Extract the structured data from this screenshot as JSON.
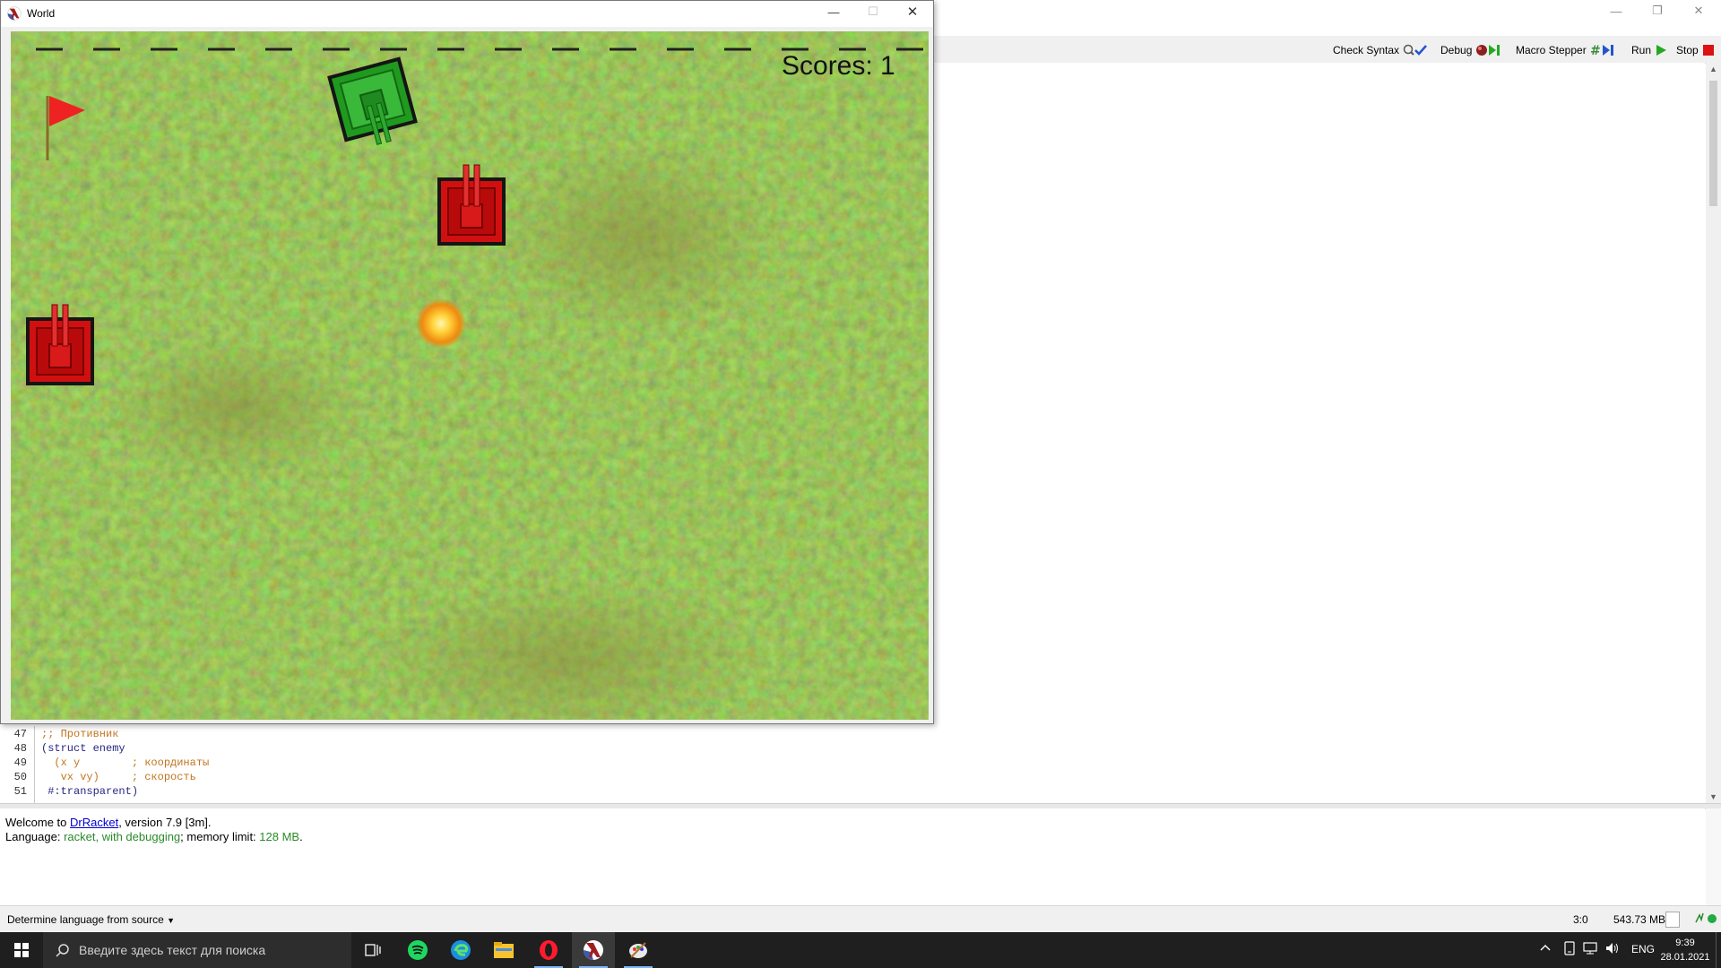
{
  "drracket": {
    "toolbar": {
      "check_syntax": "Check Syntax",
      "debug": "Debug",
      "macro_stepper": "Macro Stepper",
      "run": "Run",
      "stop": "Stop"
    },
    "code_lines": [
      {
        "num": "47",
        "text": ";; Противник"
      },
      {
        "num": "48",
        "text": "(struct enemy"
      },
      {
        "num": "49",
        "text": "  (x y        ; координаты"
      },
      {
        "num": "50",
        "text": "   vx vy)     ; скорость"
      },
      {
        "num": "51",
        "text": " #:transparent)"
      }
    ],
    "repl": {
      "welcome_prefix": "Welcome to ",
      "welcome_link": "DrRacket",
      "welcome_suffix": ", version 7.9 [3m].",
      "lang_label": "Language: ",
      "lang_value": "racket, with debugging",
      "mem_label": "; memory limit: ",
      "mem_value": "128 MB",
      "period": "."
    },
    "status": {
      "language_menu": "Determine language from source",
      "position": "3:0",
      "memory": "543.73 MB"
    }
  },
  "world_window": {
    "title": "World",
    "scores_text": "Scores: 1"
  },
  "taskbar": {
    "search_placeholder": "Введите здесь текст для поиска",
    "lang": "ENG",
    "time": "9:39",
    "date": "28.01.2021"
  },
  "colors": {
    "accent": "#7ab7ff",
    "grass": "#5f8f2c",
    "player_tank": "#1f9a1f",
    "enemy_tank": "#d01010",
    "flag": "#ee2222",
    "run_green": "#22aa22",
    "stop_red": "#dd1111"
  }
}
